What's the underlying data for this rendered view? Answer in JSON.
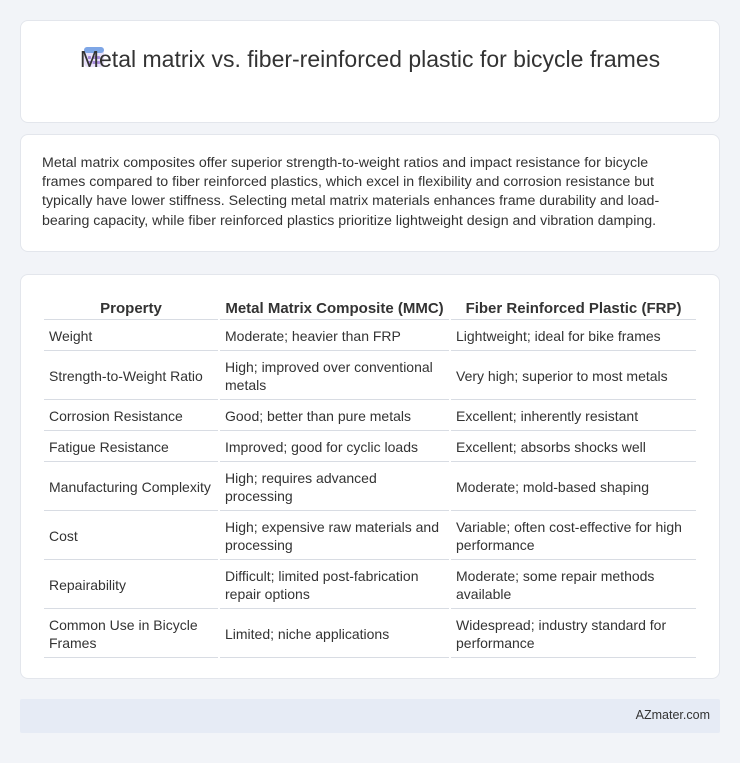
{
  "header": {
    "title": "Metal matrix vs. fiber-reinforced plastic for bicycle frames",
    "icon": "calculator-icon",
    "icon_colors": [
      "#a78bdc",
      "#7ea6e6"
    ]
  },
  "intro": {
    "text": "Metal matrix composites offer superior strength-to-weight ratios and impact resistance for bicycle frames compared to fiber reinforced plastics, which excel in flexibility and corrosion resistance but typically have lower stiffness. Selecting metal matrix materials enhances frame durability and load-bearing capacity, while fiber reinforced plastics prioritize lightweight design and vibration damping."
  },
  "table": {
    "headers": [
      "Property",
      "Metal Matrix Composite (MMC)",
      "Fiber Reinforced Plastic (FRP)"
    ],
    "rows": [
      [
        "Weight",
        "Moderate; heavier than FRP",
        "Lightweight; ideal for bike frames"
      ],
      [
        "Strength-to-Weight Ratio",
        "High; improved over conventional metals",
        "Very high; superior to most metals"
      ],
      [
        "Corrosion Resistance",
        "Good; better than pure metals",
        "Excellent; inherently resistant"
      ],
      [
        "Fatigue Resistance",
        "Improved; good for cyclic loads",
        "Excellent; absorbs shocks well"
      ],
      [
        "Manufacturing Complexity",
        "High; requires advanced processing",
        "Moderate; mold-based shaping"
      ],
      [
        "Cost",
        "High; expensive raw materials and processing",
        "Variable; often cost-effective for high performance"
      ],
      [
        "Repairability",
        "Difficult; limited post-fabrication repair options",
        "Moderate; some repair methods available"
      ],
      [
        "Common Use in Bicycle Frames",
        "Limited; niche applications",
        "Widespread; industry standard for performance"
      ]
    ]
  },
  "footer": {
    "site": "AZmater.com"
  }
}
